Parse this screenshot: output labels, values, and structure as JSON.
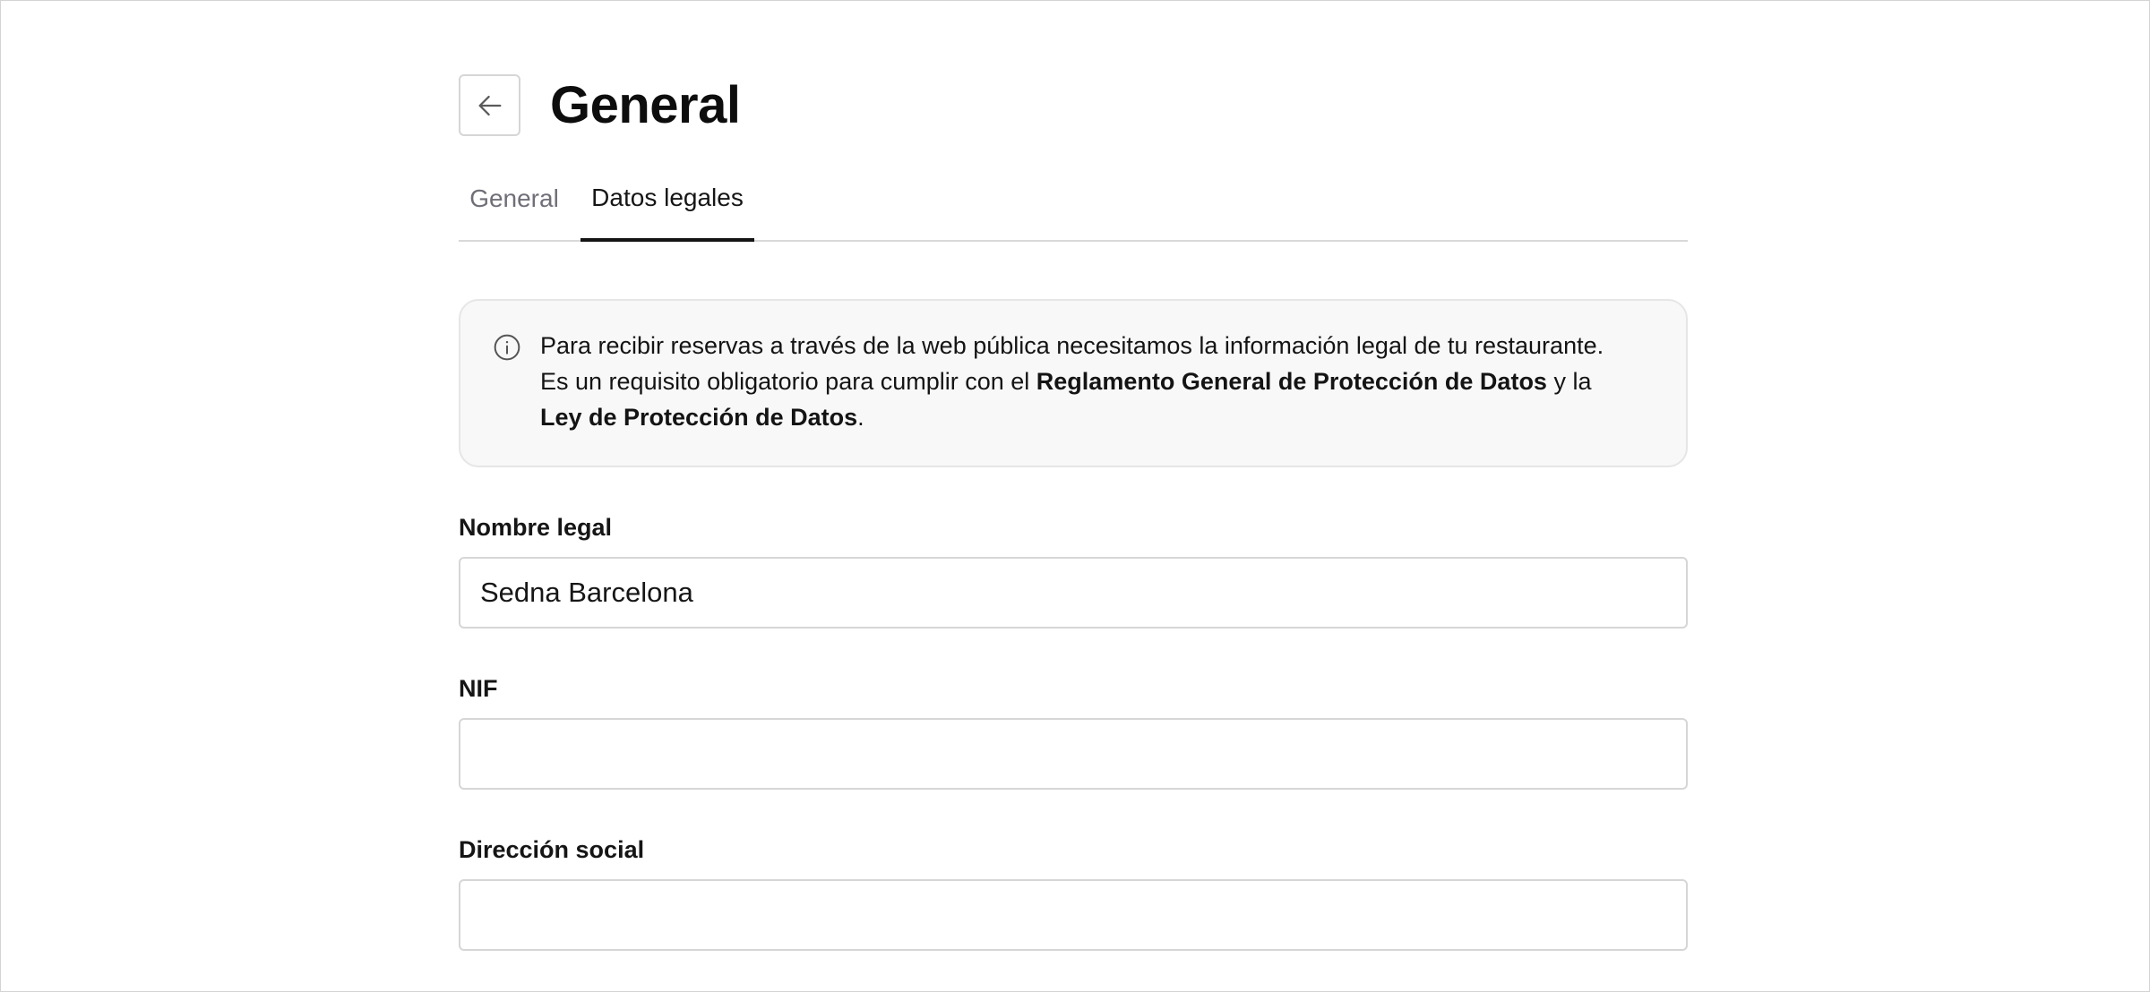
{
  "header": {
    "back_icon": "arrow-left-icon",
    "title": "General"
  },
  "tabs": [
    {
      "label": "General",
      "active": false
    },
    {
      "label": "Datos legales",
      "active": true
    }
  ],
  "info": {
    "icon": "info-circle-icon",
    "text_1": "Para recibir reservas a través de la web pública necesitamos la información legal de tu restaurante. Es un requisito obligatorio para cumplir con el ",
    "bold_1": "Reglamento General de Protección de Datos",
    "text_2": " y la ",
    "bold_2": "Ley de Protección de Datos",
    "text_3": "."
  },
  "form": {
    "legal_name": {
      "label": "Nombre legal",
      "value": "Sedna Barcelona",
      "placeholder": ""
    },
    "nif": {
      "label": "NIF",
      "value": "",
      "placeholder": ""
    },
    "address": {
      "label": "Dirección social",
      "value": "",
      "placeholder": ""
    }
  },
  "colors": {
    "border": "#d6d6d6",
    "active_tab": "#141414",
    "inactive_tab": "#6f6f78",
    "info_bg": "#f8f8f8"
  }
}
